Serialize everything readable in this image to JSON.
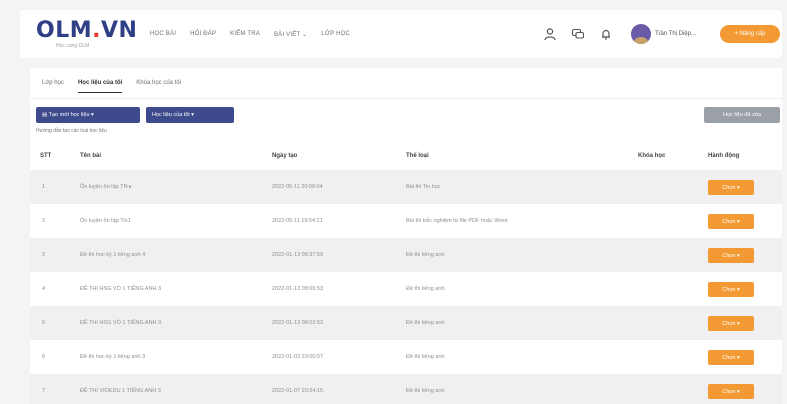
{
  "header": {
    "logo_text_a": "OLM",
    "logo_text_dot": ".",
    "logo_text_b": "VN",
    "logo_tagline": "Học cùng OLM",
    "nav": [
      "HỌC BÀI",
      "HỎI ĐÁP",
      "KIỂM TRA",
      "BÀI VIẾT ⌄",
      "LỚP HỌC"
    ],
    "user_name": "Trần Thị Diệp...",
    "action_button": "+ Nâng cấp",
    "accent": "#f39a34",
    "brand": "#2f3f86"
  },
  "tabs": [
    "Lớp học",
    "Học liệu của tôi",
    "Khóa học của tôi"
  ],
  "toolbar": {
    "create_label": "▤ Tạo mới học liệu ▾",
    "bank_label": "Học liệu của tôi ▾",
    "share_label": "Học liệu đã xóa"
  },
  "note": "Hướng dẫn tạo các loại học liệu",
  "table": {
    "columns": [
      "STT",
      "Tên bài",
      "Ngày tạo",
      "Thể loại",
      "Khóa học",
      "Hành động"
    ],
    "rows": [
      {
        "stt": "1",
        "name": "Ôn luyện ôn tập TN ▸",
        "date": "2022-05-11 20:08:04",
        "type": "Bài thi Tin học",
        "action": "Chọn ▾"
      },
      {
        "stt": "2",
        "name": "Ôn luyện ôn tập Tin1",
        "date": "2022-05-11 19:54:21",
        "type": "Bài thi trắc nghiệm từ file PDF hoặc Word",
        "action": "Chọn ▾"
      },
      {
        "stt": "3",
        "name": "Đề thi học kỳ 1 tiếng anh 4",
        "date": "2022-01-13 08:37:59",
        "type": "Đề thi tiếng anh",
        "action": "Chọn ▾"
      },
      {
        "stt": "4",
        "name": "ĐỀ THI HSG VÒ 1 TIẾNG ANH 3",
        "date": "2022-01-13 08:06:53",
        "type": "Đề thi tiếng anh",
        "action": "Chọn ▾"
      },
      {
        "stt": "5",
        "name": "ĐỀ THI HSG VÒ 1 TIẾNG ANH 3",
        "date": "2022-01-13 08:02:53",
        "type": "Đề thi tiếng anh",
        "action": "Chọn ▾"
      },
      {
        "stt": "6",
        "name": "Đề thi học kỳ 1 tiếng anh 3",
        "date": "2022-01-03 23:00:57",
        "type": "Đề thi tiếng anh",
        "action": "Chọn ▾"
      },
      {
        "stt": "7",
        "name": "ĐỀ THI VIOEDU 1 TIẾNG ANH 3",
        "date": "2022-01-07 20:24:15",
        "type": "Đề thi tiếng anh",
        "action": "Chọn ▾"
      }
    ]
  }
}
